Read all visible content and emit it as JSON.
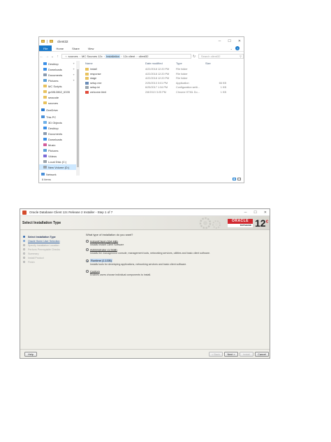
{
  "explorer": {
    "title": "client32",
    "ribbon_tabs": [
      "File",
      "Home",
      "Share",
      "View"
    ],
    "address": {
      "crumbs": [
        "sources",
        "MC Sources 12c",
        "Installation",
        "12c client",
        "client32"
      ],
      "highlighted_index": 2
    },
    "search_placeholder": "Search client32",
    "nav": [
      {
        "label": "Desktop",
        "icon": "desktop-icon",
        "pinned": true
      },
      {
        "label": "Downloads",
        "icon": "downloads-icon",
        "pinned": true
      },
      {
        "label": "Documents",
        "icon": "documents-icon",
        "pinned": true
      },
      {
        "label": "Pictures",
        "icon": "pictures-icon",
        "pinned": true
      },
      {
        "label": "MC Scripts",
        "icon": "folder-icon",
        "pinned": false
      },
      {
        "label": "gc9812862_6335",
        "icon": "folder-icon",
        "pinned": false
      },
      {
        "label": "seacode",
        "icon": "folder-icon",
        "pinned": false
      },
      {
        "label": "sources",
        "icon": "folder-icon",
        "pinned": false
      },
      {
        "label": "OneDrive",
        "icon": "onedrive-icon",
        "pinned": false
      },
      {
        "label": "This PC",
        "icon": "this-pc-icon",
        "pinned": false
      },
      {
        "label": "3D Objects",
        "icon": "3d-objects-icon",
        "pinned": false
      },
      {
        "label": "Desktop",
        "icon": "desktop-icon",
        "pinned": false
      },
      {
        "label": "Documents",
        "icon": "documents-icon",
        "pinned": false
      },
      {
        "label": "Downloads",
        "icon": "downloads-icon",
        "pinned": false
      },
      {
        "label": "Music",
        "icon": "music-icon",
        "pinned": false
      },
      {
        "label": "Pictures",
        "icon": "pictures-icon",
        "pinned": false
      },
      {
        "label": "Videos",
        "icon": "videos-icon",
        "pinned": false
      },
      {
        "label": "Local Disk (C:)",
        "icon": "drive-icon",
        "pinned": false
      },
      {
        "label": "New Volume (D:)",
        "icon": "drive-icon",
        "pinned": false,
        "selected": true
      },
      {
        "label": "Network",
        "icon": "network-icon",
        "pinned": false
      }
    ],
    "columns": [
      "Name",
      "Date modified",
      "Type",
      "Size"
    ],
    "files": [
      {
        "name": "install",
        "date": "4/22/2018 12:20 PM",
        "type": "File folder",
        "size": "",
        "icon": "folder-icon"
      },
      {
        "name": "response",
        "date": "4/22/2018 12:20 PM",
        "type": "File folder",
        "size": "",
        "icon": "folder-icon"
      },
      {
        "name": "stage",
        "date": "4/22/2018 12:20 PM",
        "type": "File folder",
        "size": "",
        "icon": "folder-icon"
      },
      {
        "name": "setup.exe",
        "date": "2/25/2013 3:01 PM",
        "type": "Application",
        "size": "66 KB",
        "icon": "exe-icon"
      },
      {
        "name": "setup.ini",
        "date": "6/25/2017 1:34 PM",
        "type": "Configuration setti...",
        "size": "1 KB",
        "icon": "config-icon"
      },
      {
        "name": "welcome.html",
        "date": "2/8/2013 3:25 PM",
        "type": "Chrome HTML Do...",
        "size": "1 KB",
        "icon": "chrome-icon"
      }
    ],
    "status": "6 items"
  },
  "installer": {
    "title": "Oracle Database Client 12c Release 2 Installer - Step 1 of 7",
    "section_title": "Select Installation Type",
    "logo_text": "ORACLE",
    "logo_sub": "DATABASE",
    "version": "12",
    "version_sup": "c",
    "steps": [
      {
        "label": "Select Installation Type",
        "state": "current"
      },
      {
        "label": "Oracle Home User Selection",
        "state": "link"
      },
      {
        "label": "Specify Installation Location",
        "state": "pending"
      },
      {
        "label": "Perform Prerequisite Checks",
        "state": "pending"
      },
      {
        "label": "Summary",
        "state": "pending"
      },
      {
        "label": "Install Product",
        "state": "pending"
      },
      {
        "label": "Finish",
        "state": "pending"
      }
    ],
    "question": "What type of installation do you want?",
    "options": [
      {
        "label": "InstantClient (334 MB)",
        "desc": "Installs Instant Client Software",
        "selected": false
      },
      {
        "label": "Administrator (1.5GB)",
        "desc": "Installs the management console, management tools, networking services, utilities and basic client software.",
        "selected": false
      },
      {
        "label": "Runtime (1.1GB)",
        "desc": "Installs tools for developing applications, networking services and basic client software.",
        "selected": true
      },
      {
        "label": "Custom",
        "desc": "Enables users choose individual components to install.",
        "selected": false
      }
    ],
    "buttons": {
      "help": "Help",
      "back": "< Back",
      "next": "Next >",
      "install": "Install",
      "cancel": "Cancel"
    }
  }
}
